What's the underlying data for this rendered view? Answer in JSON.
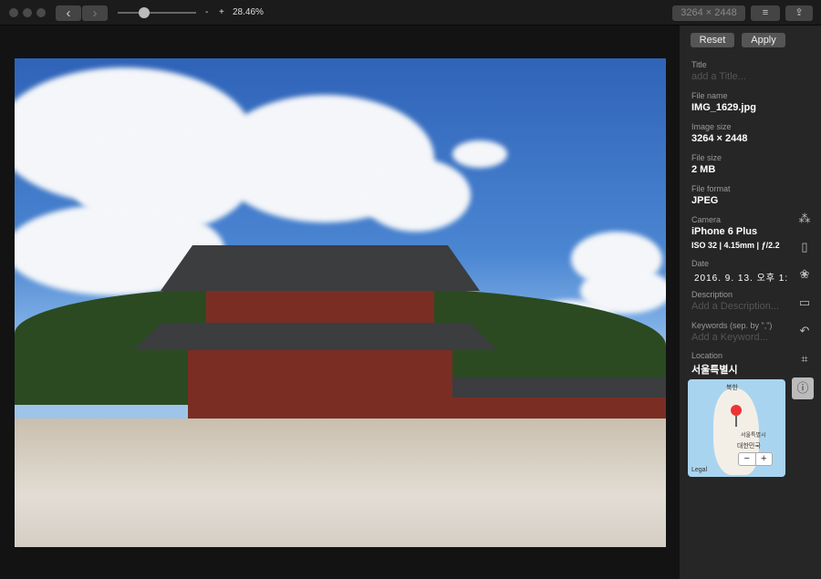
{
  "toolbar": {
    "zoom_minus": "-",
    "zoom_plus": "+",
    "zoom_level": "28.46%",
    "zoom_slider_fraction": 0.3,
    "dimensions": "3264 × 2448",
    "back": "‹",
    "forward": "›"
  },
  "sidebar": {
    "reset": "Reset",
    "apply": "Apply",
    "title_label": "Title",
    "title_placeholder": "add a Title...",
    "filename_label": "File name",
    "filename": "IMG_1629.jpg",
    "imagesize_label": "Image size",
    "imagesize": "3264 × 2448",
    "filesize_label": "File size",
    "filesize": "2 MB",
    "format_label": "File format",
    "format": "JPEG",
    "camera_label": "Camera",
    "camera": "iPhone 6 Plus",
    "exposure": "ISO 32 | 4.15mm | ƒ/2.2",
    "date_label": "Date",
    "date": "2016. 9. 13. 오후 1:",
    "description_label": "Description",
    "description_placeholder": "Add a Description...",
    "keywords_label": "Keywords (sep. by \",\")",
    "keywords_placeholder": "Add a Keyword...",
    "location_label": "Location",
    "location": "서울특별시",
    "map": {
      "north": "북한",
      "city": "서울특별시",
      "country": "대한민국",
      "legal": "Legal",
      "zoom_out": "−",
      "zoom_in": "+"
    }
  }
}
